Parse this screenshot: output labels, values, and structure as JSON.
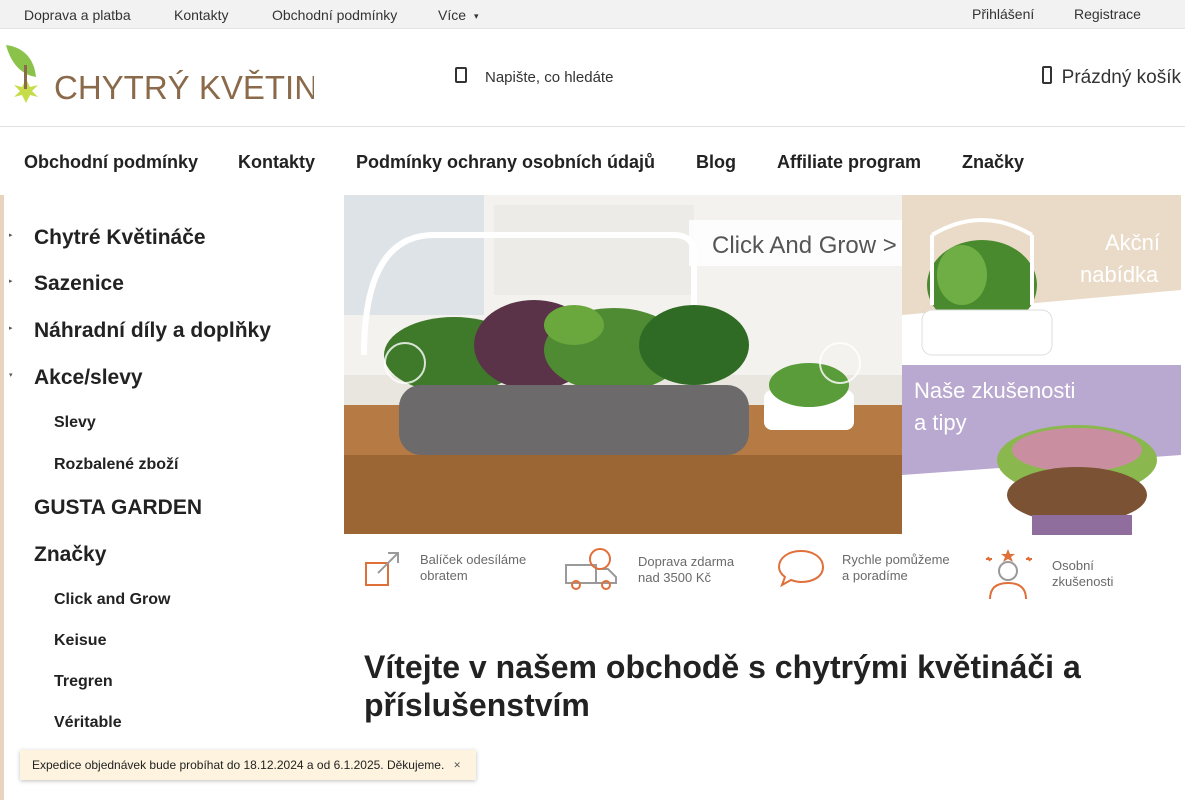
{
  "topbar": {
    "links": [
      "Doprava a platba",
      "Kontakty",
      "Obchodní podmínky"
    ],
    "more": "Více",
    "login": "Přihlášení",
    "register": "Registrace"
  },
  "header": {
    "logo_text": "CHYTRÝ KVĚTINÁČ",
    "search_placeholder": "Napište, co hledáte",
    "cart_label": "Prázdný košík"
  },
  "mainnav": [
    "Obchodní podmínky",
    "Kontakty",
    "Podmínky ochrany osobních údajů",
    "Blog",
    "Affiliate program",
    "Značky"
  ],
  "sidebar": {
    "categories": [
      "Chytré Květináče",
      "Sazenice",
      "Náhradní díly a doplňky",
      "Akce/slevy"
    ],
    "akce_subitems": [
      "Slevy",
      "Rozbalené zboží"
    ],
    "gusta": "GUSTA GARDEN",
    "brands_title": "Značky",
    "brands": [
      "Click and Grow",
      "Keisue",
      "Tregren",
      "Véritable"
    ]
  },
  "banners": {
    "main_caption": "Click And Grow >",
    "side1_caption": [
      "Akční",
      "nabídka"
    ],
    "side2_caption": [
      "Naše zkušenosti",
      "a tipy"
    ]
  },
  "benefits": [
    {
      "icon": "package-arrow-icon",
      "lines": [
        "Balíček odesíláme",
        "obratem"
      ]
    },
    {
      "icon": "delivery-truck-icon",
      "lines": [
        "Doprava zdarma",
        "nad 3500 Kč"
      ]
    },
    {
      "icon": "speech-bubble-icon",
      "lines": [
        "Rychle pomůžeme",
        "a poradíme"
      ]
    },
    {
      "icon": "person-stars-icon",
      "lines": [
        "Osobní",
        "zkušenosti"
      ]
    }
  ],
  "welcome_title": "Vítejte v našem obchodě s chytrými květináči a příslušenstvím",
  "notice": "Expedice objednávek bude probíhat do 18.12.2024 a od 6.1.2025. Děkujeme.",
  "colors": {
    "brand_green": "#8bc34a",
    "brand_brown": "#8a6a4a",
    "benefit_orange": "#e0703a"
  }
}
